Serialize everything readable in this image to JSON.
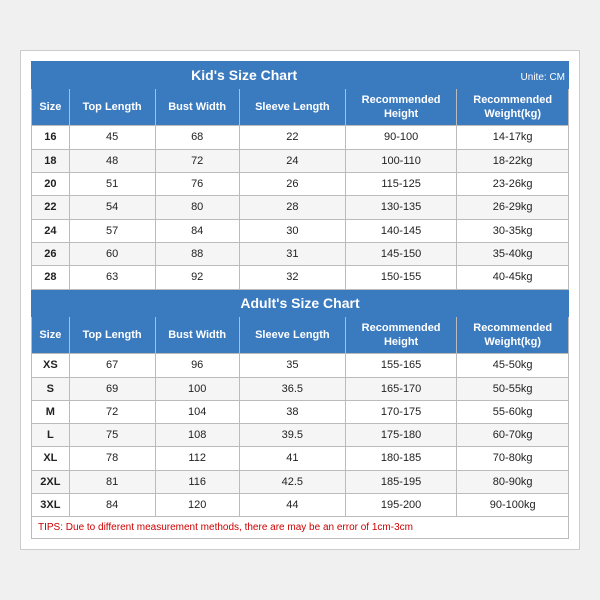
{
  "kids": {
    "title": "Kid's Size Chart",
    "unit": "Unite: CM",
    "headers": [
      "Size",
      "Top Length",
      "Bust Width",
      "Sleeve Length",
      "Recommended\nHeight",
      "Recommended\nWeight(kg)"
    ],
    "rows": [
      [
        "16",
        "45",
        "68",
        "22",
        "90-100",
        "14-17kg"
      ],
      [
        "18",
        "48",
        "72",
        "24",
        "100-110",
        "18-22kg"
      ],
      [
        "20",
        "51",
        "76",
        "26",
        "115-125",
        "23-26kg"
      ],
      [
        "22",
        "54",
        "80",
        "28",
        "130-135",
        "26-29kg"
      ],
      [
        "24",
        "57",
        "84",
        "30",
        "140-145",
        "30-35kg"
      ],
      [
        "26",
        "60",
        "88",
        "31",
        "145-150",
        "35-40kg"
      ],
      [
        "28",
        "63",
        "92",
        "32",
        "150-155",
        "40-45kg"
      ]
    ]
  },
  "adults": {
    "title": "Adult's Size Chart",
    "headers": [
      "Size",
      "Top Length",
      "Bust Width",
      "Sleeve Length",
      "Recommended\nHeight",
      "Recommended\nWeight(kg)"
    ],
    "rows": [
      [
        "XS",
        "67",
        "96",
        "35",
        "155-165",
        "45-50kg"
      ],
      [
        "S",
        "69",
        "100",
        "36.5",
        "165-170",
        "50-55kg"
      ],
      [
        "M",
        "72",
        "104",
        "38",
        "170-175",
        "55-60kg"
      ],
      [
        "L",
        "75",
        "108",
        "39.5",
        "175-180",
        "60-70kg"
      ],
      [
        "XL",
        "78",
        "112",
        "41",
        "180-185",
        "70-80kg"
      ],
      [
        "2XL",
        "81",
        "116",
        "42.5",
        "185-195",
        "80-90kg"
      ],
      [
        "3XL",
        "84",
        "120",
        "44",
        "195-200",
        "90-100kg"
      ]
    ]
  },
  "tips": "TIPS: Due to different measurement methods, there are may be an error of 1cm-3cm"
}
